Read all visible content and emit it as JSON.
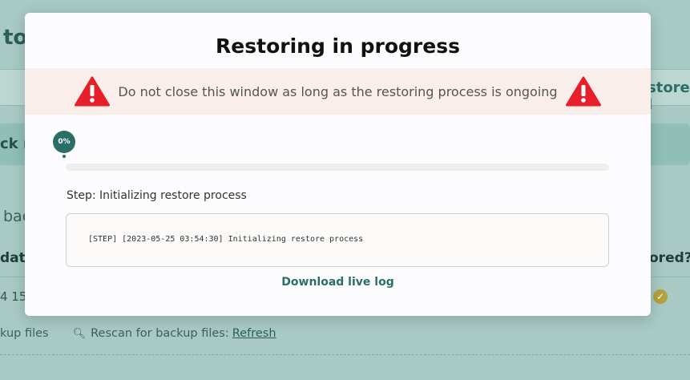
{
  "background": {
    "title_fragment": "to",
    "tab_right": "store l",
    "band_text": "ck r",
    "subtitle": "bac",
    "column_left": "date",
    "column_right": "ored?",
    "row_left": "4 15:",
    "footer_left": "kup files",
    "footer_rescan_label": "Rescan for backup files:",
    "footer_refresh_link": "Refresh"
  },
  "modal": {
    "title": "Restoring in progress",
    "warning_text": "Do not close this window as long as the restoring process is ongoing",
    "progress_label": "0%",
    "progress_value": 0,
    "step_text": "Step: Initializing restore process",
    "log_lines": [
      "[STEP] [2023-05-25 03:54:30] Initializing restore process"
    ],
    "download_link": "Download live log"
  },
  "colors": {
    "accent": "#2a6e67",
    "warning_red": "#e5202a",
    "warning_band": "#faeeeb"
  }
}
